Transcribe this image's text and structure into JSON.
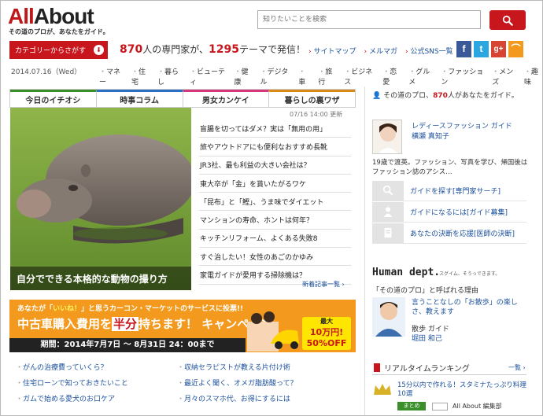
{
  "header": {
    "logo_text": "AllAbout",
    "tagline": "その道のプロが、あなたをガイド。",
    "search_placeholder": "知りたいことを検索",
    "category_button": "カテゴリーからさがす",
    "promo": {
      "guides": "870",
      "mid": "人の専門家が、",
      "themes": "1295",
      "end": "テーマで発信！"
    },
    "links": [
      "サイトマップ",
      "メルマガ",
      "公式SNS一覧"
    ],
    "social_icons": [
      "facebook-icon",
      "twitter-icon",
      "googleplus-icon",
      "rss-icon"
    ]
  },
  "date": "2014.07.16（Wed）",
  "categories": [
    "マネー",
    "住宅",
    "暮らし",
    "ビューティ",
    "健康",
    "デジタル",
    "車",
    "旅行",
    "ビジネス",
    "恋愛",
    "グルメ",
    "ファッション",
    "メンズ",
    "趣味"
  ],
  "tabs": [
    "今日のイチオシ",
    "時事コラム",
    "男女カンケイ",
    "暮らしの裏ワザ"
  ],
  "hero_caption": "自分でできる本格的な動物の撮り方",
  "news_meta": "07/16 14:00  更新",
  "news": [
    "盲腸を切ってはダメ？実は「無用の用」",
    "旅やアウトドアにも便利なおすすめ長靴",
    "JR3社、最も利益の大きい会社は？",
    "東大卒が「金」を貰いたがるワケ",
    "「昆布」と「鰹」、うま味でダイエット",
    "マンションの寿命、ホントは何年？",
    "キッチンリフォーム、よくある失敗8",
    "すぐ治したい！女性のあごのかゆみ",
    "家電ガイドが愛用する掃除機は？"
  ],
  "news_more": "新着記事一覧 ›",
  "banner": {
    "line1_a": "あなたが「",
    "line1_b": "いいね！",
    "line1_c": "」と思うカーコン・マーケットのサービスに投票!!",
    "line2_a": "中古車購入費用を",
    "line2_b": "半分",
    "line2_c": "持ちます！ キャンペーン",
    "period": "期間：2014年7月7日 〜 8月31日 24：00まで",
    "badge_s": "最大",
    "badge_m": "10万円!",
    "badge_l": "50%OFF"
  },
  "bottom_links": [
    "がんの治療費っていくら？",
    "収納セラピストが教える片付け術",
    "住宅ローンで知っておきたいこと",
    "最近よく聞く、オメガ脂肪酸って？",
    "ガムで始める愛犬のお口ケア",
    "月々のスマホ代、お得にするには"
  ],
  "right": {
    "header_pre": "その道のプロ、",
    "header_num": "870",
    "header_post": "人があなたをガイド。",
    "guide_name_1": "レディースファッション ガイド",
    "guide_name_2": "横瀬 真知子",
    "guide_desc": "19歳で渡英。ファッション、写真を学び、帰国後はファッション誌のアシス…",
    "menu": [
      "ガイドを探す[専門家サーチ]",
      "ガイドになるには[ガイド募集]",
      "あなたの決断を応援[医師の決断]"
    ],
    "hdept": "Human dept.",
    "hdept_sub": "スグイム、そうっできます。",
    "pro_question": "「その道のプロ」と呼ばれる理由",
    "pro_title": "言うことなしの「お散歩」の楽しさ、教えます",
    "pro_role": "散歩 ガイド",
    "pro_name": "堀田 和己",
    "ranking_title": "リアルタイムランキング",
    "ranking_more": "一覧 ›",
    "ranking_item": "15分以内で作れる！スタミナたっぷり料理10選",
    "ranking_cat": "まとめ",
    "ranking_src": "All About 編集部"
  }
}
